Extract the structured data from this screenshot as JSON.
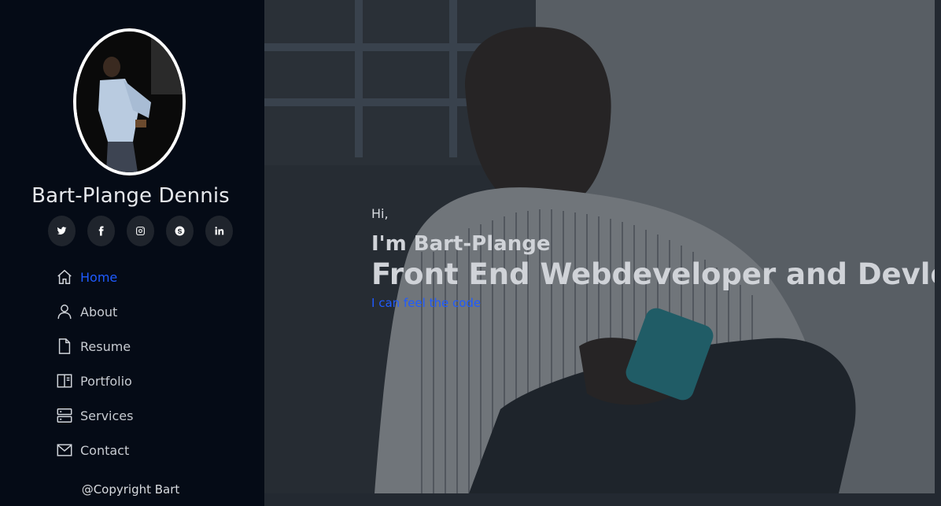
{
  "profile": {
    "name": "Bart-Plange Dennis",
    "avatar_icon": "profile-photo"
  },
  "socials": [
    {
      "icon": "twitter-icon"
    },
    {
      "icon": "facebook-icon"
    },
    {
      "icon": "instagram-icon"
    },
    {
      "icon": "skype-icon"
    },
    {
      "icon": "linkedin-icon"
    }
  ],
  "nav": {
    "items": [
      {
        "label": "Home",
        "icon": "home-icon",
        "active": true
      },
      {
        "label": "About",
        "icon": "person-icon",
        "active": false
      },
      {
        "label": "Resume",
        "icon": "file-icon",
        "active": false
      },
      {
        "label": "Portfolio",
        "icon": "layout-icon",
        "active": false
      },
      {
        "label": "Services",
        "icon": "server-icon",
        "active": false
      },
      {
        "label": "Contact",
        "icon": "envelope-icon",
        "active": false
      }
    ]
  },
  "footer": {
    "copyright": "@Copyright Bart"
  },
  "hero": {
    "greeting": "Hi,",
    "intro": "I'm Bart-Plange",
    "title": "Front End Webdeveloper and Devloper",
    "tagline": "I can feel the code"
  },
  "colors": {
    "sidebar_bg": "#050b16",
    "accent": "#1f5bff",
    "page_bg": "#232931"
  }
}
